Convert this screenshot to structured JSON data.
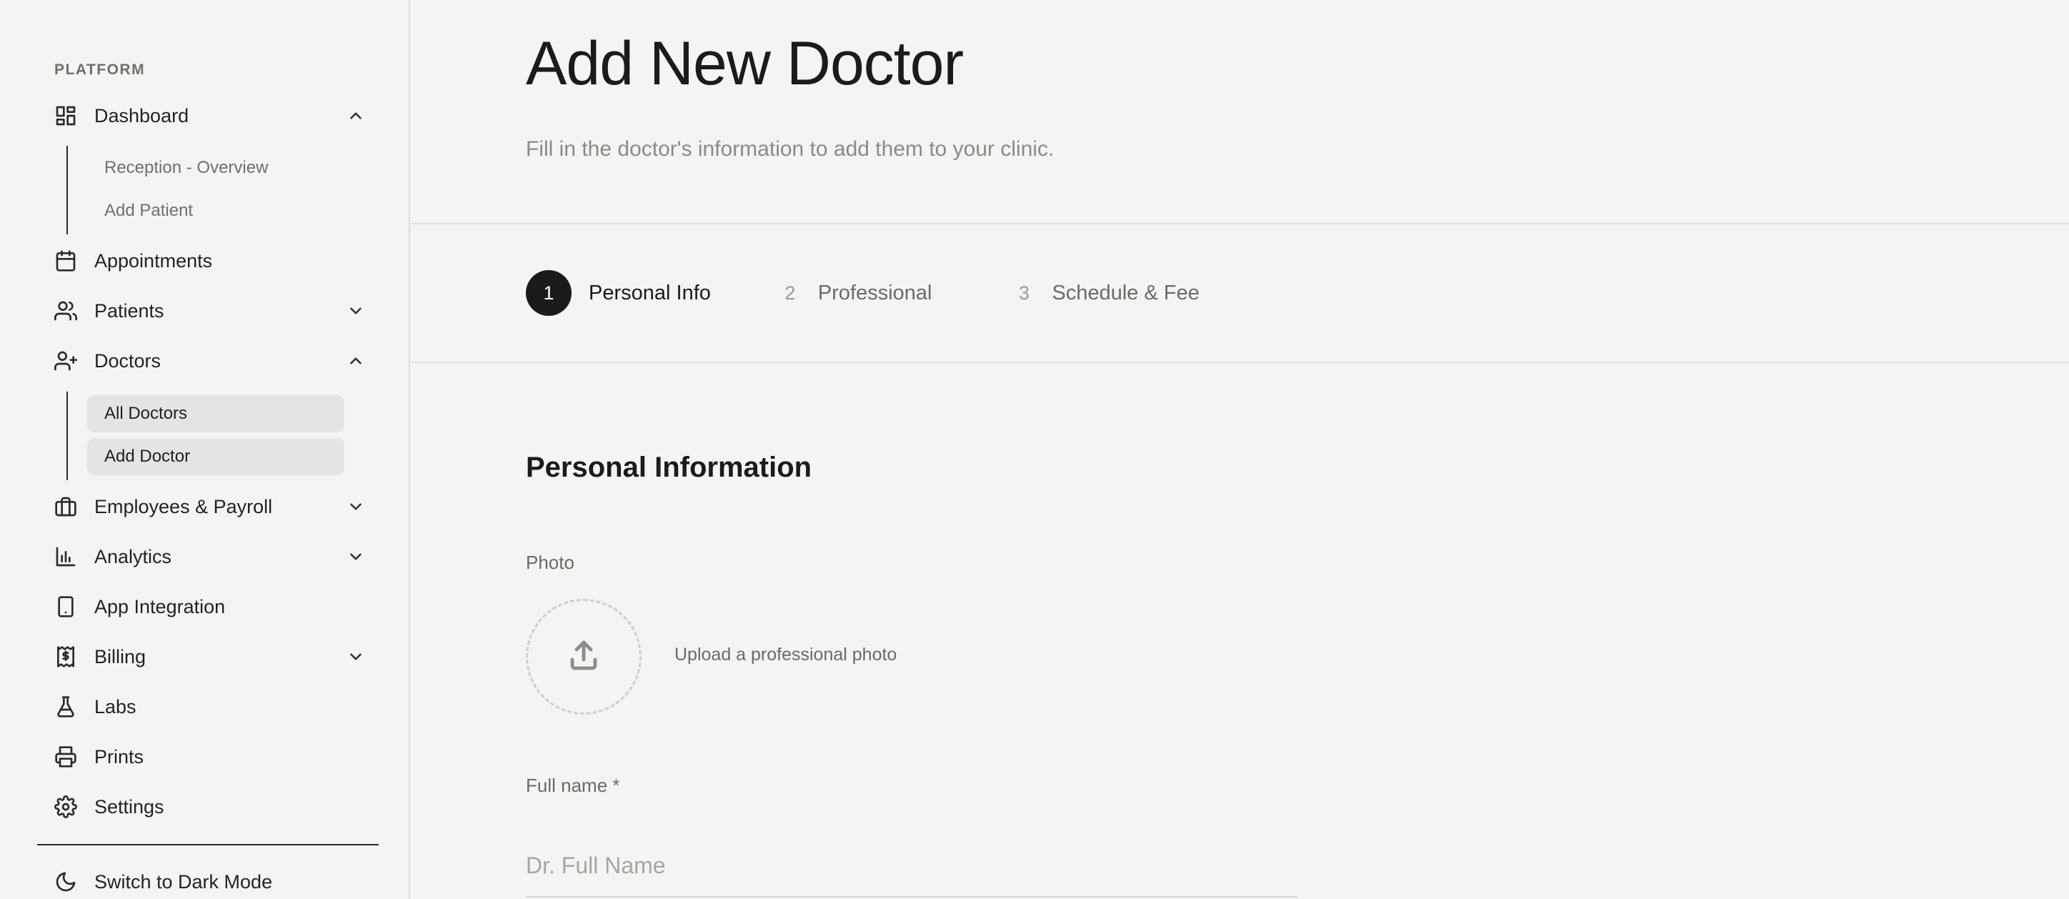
{
  "sidebar": {
    "section_label": "PLATFORM",
    "items": {
      "dashboard": {
        "label": "Dashboard",
        "icon": "dashboard-icon",
        "expanded": true
      },
      "appointments": {
        "label": "Appointments",
        "icon": "calendar-icon"
      },
      "patients": {
        "label": "Patients",
        "icon": "users-icon",
        "expanded": false
      },
      "doctors": {
        "label": "Doctors",
        "icon": "user-plus-icon",
        "expanded": true
      },
      "employees": {
        "label": "Employees & Payroll",
        "icon": "briefcase-icon",
        "expanded": false
      },
      "analytics": {
        "label": "Analytics",
        "icon": "bar-chart-icon",
        "expanded": false
      },
      "app_integration": {
        "label": "App Integration",
        "icon": "tablet-icon"
      },
      "billing": {
        "label": "Billing",
        "icon": "receipt-icon",
        "expanded": false
      },
      "labs": {
        "label": "Labs",
        "icon": "flask-icon"
      },
      "prints": {
        "label": "Prints",
        "icon": "printer-icon"
      },
      "settings": {
        "label": "Settings",
        "icon": "gear-icon"
      },
      "dark_mode": {
        "label": "Switch to Dark Mode",
        "icon": "moon-icon"
      }
    },
    "dashboard_sub": [
      "Reception - Overview",
      "Add Patient"
    ],
    "doctors_sub": [
      "All Doctors",
      "Add Doctor"
    ]
  },
  "main": {
    "title": "Add New Doctor",
    "subtitle": "Fill in the doctor's information to add them to your clinic.",
    "steps": [
      {
        "number": "1",
        "label": "Personal Info",
        "active": true
      },
      {
        "number": "2",
        "label": "Professional",
        "active": false
      },
      {
        "number": "3",
        "label": "Schedule & Fee",
        "active": false
      }
    ],
    "section_title": "Personal Information",
    "photo": {
      "label": "Photo",
      "hint": "Upload a professional photo"
    },
    "full_name": {
      "label": "Full name *",
      "placeholder": "Dr. Full Name",
      "value": ""
    }
  },
  "colors": {
    "background": "#f4f4f3",
    "active_step": "#1a1a1a",
    "active_sub_bg": "#e4e4e2"
  }
}
